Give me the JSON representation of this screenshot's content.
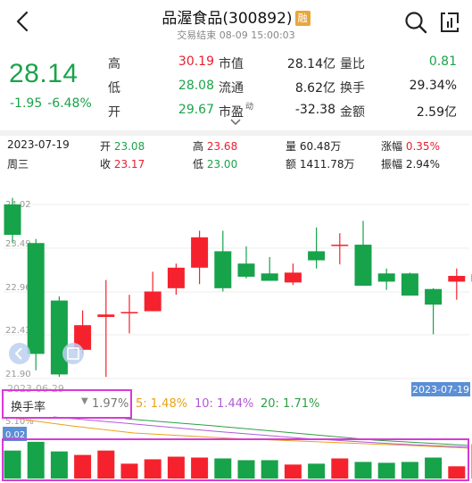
{
  "header": {
    "title": "品渥食品(300892)",
    "badge": "融",
    "status": "交易结束 08-09 15:00:03"
  },
  "quote": {
    "price": "28.14",
    "change": "-1.95",
    "change_pct": "-6.48%",
    "high_label": "高",
    "high": "30.19",
    "low_label": "低",
    "low": "28.08",
    "open_label": "开",
    "open": "29.67",
    "mktcap_label": "市值",
    "mktcap": "28.14亿",
    "float_label": "流通",
    "float": "8.62亿",
    "pe_label": "市盈",
    "pe_sup": "动",
    "pe": "-32.38",
    "volratio_label": "量比",
    "volratio": "0.81",
    "turnover_label": "换手",
    "turnover": "29.34%",
    "amount_label": "金额",
    "amount": "2.59亿"
  },
  "day_info": {
    "date": "2023-07-19",
    "weekday": "周三",
    "open_label": "开",
    "open": "23.08",
    "close_label": "收",
    "close": "23.17",
    "high_label": "高",
    "high": "23.68",
    "low_label": "低",
    "low": "23.00",
    "vol_label": "量",
    "vol": "60.48万",
    "amount_label": "额",
    "amount": "1411.78万",
    "chg_label": "涨幅",
    "chg": "0.35%",
    "amp_label": "振幅",
    "amp": "2.94%"
  },
  "indicator": {
    "name": "换手率",
    "current": "1.97%",
    "ma5": "5: 1.48%",
    "ma10": "10: 1.44%",
    "ma20": "20: 1.71%",
    "axis_top": "5.10%",
    "axis_bottom": "0.02"
  },
  "colors": {
    "up": "#f5222d",
    "down": "#16a34a",
    "ma5": "#e8a317",
    "ma10": "#b15ad6",
    "ma20": "#2f9e44",
    "highlight": "#d63bd6"
  },
  "chart_data": {
    "type": "candlestick",
    "y_ticks": [
      "24.02",
      "23.49",
      "22.96",
      "22.43",
      "21.90"
    ],
    "ylim": [
      21.9,
      24.02
    ],
    "x_start_label": "2023-06-29",
    "crosshair_date": "2023-07-19",
    "candles": [
      {
        "open": 24.02,
        "close": 23.65,
        "high": 24.1,
        "low": 23.55
      },
      {
        "open": 23.55,
        "close": 22.2,
        "high": 23.6,
        "low": 22.0
      },
      {
        "open": 22.85,
        "close": 21.95,
        "high": 22.9,
        "low": 21.92
      },
      {
        "open": 22.25,
        "close": 22.55,
        "high": 22.73,
        "low": 22.2
      },
      {
        "open": 22.65,
        "close": 22.68,
        "high": 23.1,
        "low": 21.92
      },
      {
        "open": 22.7,
        "close": 22.71,
        "high": 22.92,
        "low": 22.45
      },
      {
        "open": 22.72,
        "close": 22.96,
        "high": 23.2,
        "low": 22.72
      },
      {
        "open": 23.0,
        "close": 23.25,
        "high": 23.3,
        "low": 22.92
      },
      {
        "open": 23.25,
        "close": 23.62,
        "high": 23.7,
        "low": 23.05
      },
      {
        "open": 23.45,
        "close": 23.0,
        "high": 23.7,
        "low": 22.96
      },
      {
        "open": 23.3,
        "close": 23.14,
        "high": 23.51,
        "low": 23.12
      },
      {
        "open": 23.18,
        "close": 23.09,
        "high": 23.38,
        "low": 23.09
      },
      {
        "open": 23.07,
        "close": 23.19,
        "high": 23.3,
        "low": 23.04
      },
      {
        "open": 23.45,
        "close": 23.34,
        "high": 23.74,
        "low": 23.24
      },
      {
        "open": 23.53,
        "close": 23.53,
        "high": 23.67,
        "low": 23.29
      },
      {
        "open": 23.53,
        "close": 23.03,
        "high": 23.82,
        "low": 23.03
      },
      {
        "open": 23.18,
        "close": 23.08,
        "high": 23.24,
        "low": 22.98
      },
      {
        "open": 23.18,
        "close": 22.91,
        "high": 23.19,
        "low": 22.91
      },
      {
        "open": 22.99,
        "close": 22.8,
        "high": 23.0,
        "low": 22.44
      },
      {
        "open": 23.08,
        "close": 23.15,
        "high": 23.24,
        "low": 22.86
      },
      {
        "open": 23.08,
        "close": 23.17,
        "high": 23.68,
        "low": 23.0
      }
    ],
    "turnover": [
      1.6,
      2.1,
      1.55,
      1.35,
      1.6,
      0.85,
      1.1,
      1.25,
      1.2,
      1.15,
      1.05,
      1.05,
      0.8,
      0.85,
      1.15,
      0.95,
      0.9,
      0.95,
      1.2,
      0.7,
      1.97
    ]
  }
}
